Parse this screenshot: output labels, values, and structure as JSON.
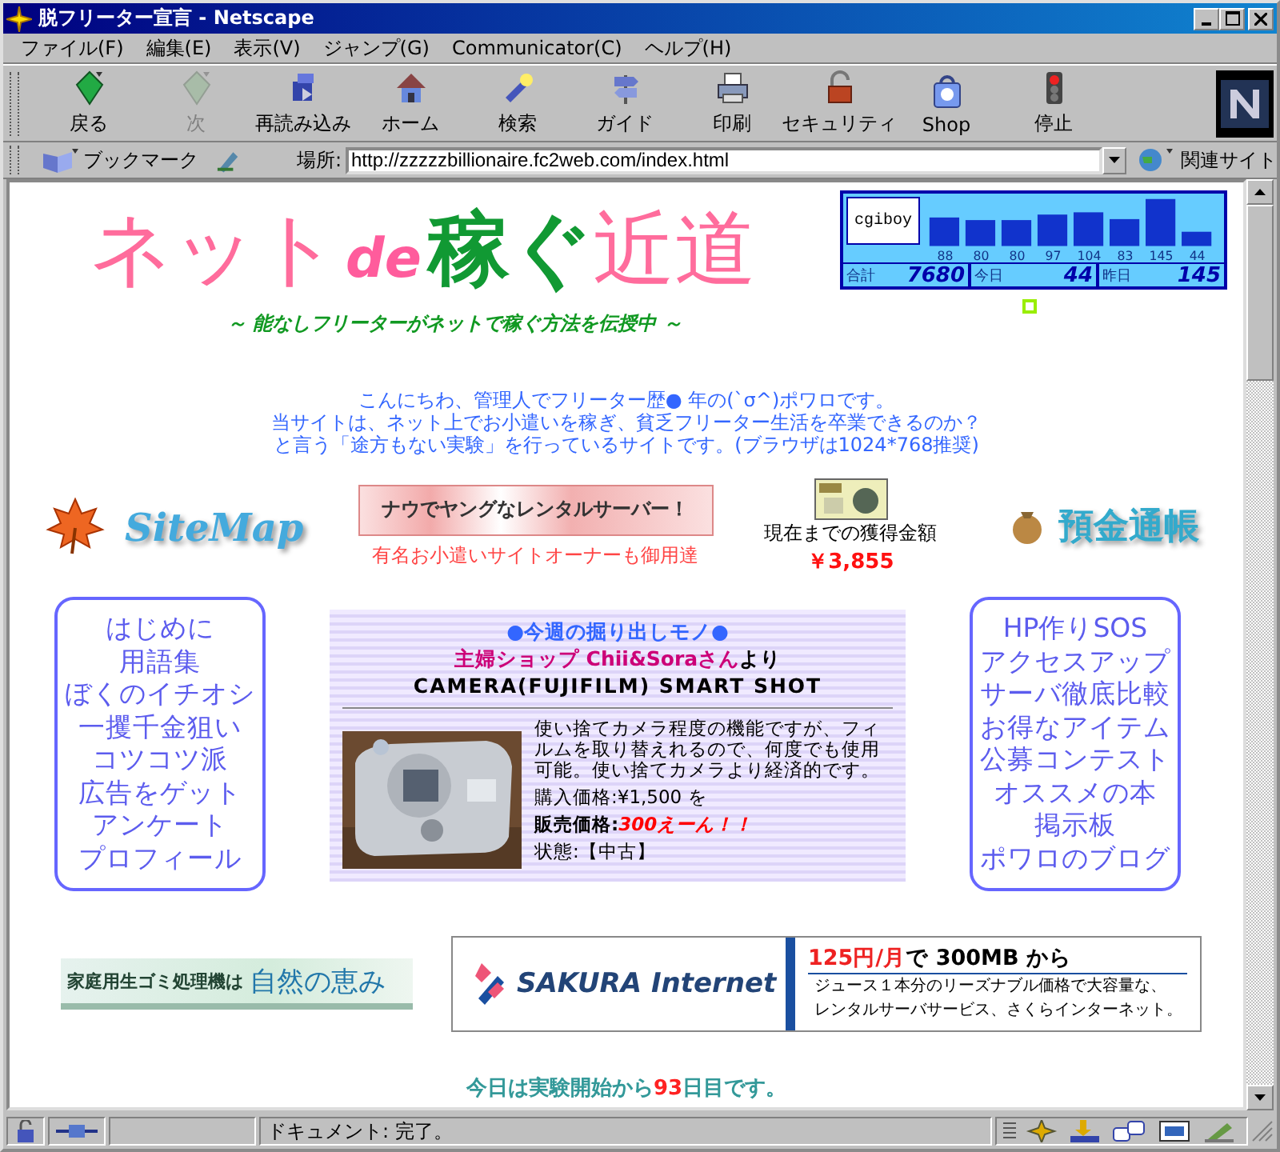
{
  "window": {
    "title": "脱フリーター宣言 - Netscape"
  },
  "menu": [
    "ファイル(F)",
    "編集(E)",
    "表示(V)",
    "ジャンプ(G)",
    "Communicator(C)",
    "ヘルプ(H)"
  ],
  "toolbar": [
    {
      "label": "戻る",
      "disabled": false
    },
    {
      "label": "次",
      "disabled": true
    },
    {
      "label": "再読み込み",
      "disabled": false
    },
    {
      "label": "ホーム",
      "disabled": false
    },
    {
      "label": "検索",
      "disabled": false
    },
    {
      "label": "ガイド",
      "disabled": false
    },
    {
      "label": "印刷",
      "disabled": false
    },
    {
      "label": "セキュリティ",
      "disabled": false
    },
    {
      "label": "Shop",
      "disabled": false
    },
    {
      "label": "停止",
      "disabled": false
    }
  ],
  "location_bar": {
    "bookmarks": "ブックマーク",
    "location_label": "場所:",
    "url": "http://zzzzzbillionaire.fc2web.com/index.html",
    "related": "関連サイト"
  },
  "page": {
    "logo": {
      "part_1": "ネット",
      "part_2": "de",
      "part_3": "稼ぐ",
      "part_4": "近道"
    },
    "tagline": "～ 能なしフリーターがネットで稼ぐ方法を伝授中 ～",
    "counter": {
      "brand": "cgiboy",
      "daily_counts": [
        "88",
        "80",
        "80",
        "97",
        "104",
        "83",
        "145",
        "44"
      ],
      "total_label": "合計",
      "total": "7680",
      "today_label": "今日",
      "today": "44",
      "yesterday_label": "昨日",
      "yesterday": "145"
    },
    "intro": [
      "こんにちわ、管理人でフリーター歴● 年の(`σ^)ポワロです。",
      "当サイトは、ネット上でお小遣いを稼ぎ、貧乏フリーター生活を卒業できるのか？",
      "と言う「途方もない実験」を行っているサイトです。(ブラウザは1024*768推奨)"
    ],
    "sitemap": "SiteMap",
    "rental_banner": "ナウでヤングなレンタルサーバー！",
    "rental_caption": "有名お小遣いサイトオーナーも御用達",
    "earnings_label": "現在までの獲得金額",
    "earnings": "￥3,855",
    "passbook": "預金通帳",
    "left_menu": [
      "はじめに",
      "用語集",
      "ぼくのイチオシ",
      "一攫千金狙い",
      "コツコツ派",
      "広告をゲット",
      "アンケート",
      "プロフィール"
    ],
    "feature": {
      "heading": "●今週の掘り出しモノ●",
      "shop": "主婦ショップ Chii&Soraさん",
      "shop_suffix": "より",
      "product": "CAMERA(FUJIFILM) SMART SHOT",
      "description": "使い捨てカメラ程度の機能ですが、フィルムを取り替えれるので、何度でも使用可能。使い捨てカメラより経済的です。",
      "purchase_price": "購入価格:¥1,500 を",
      "sale_label": "販売価格:",
      "sale_price": "300えーん！！",
      "condition": "状態:【中古】"
    },
    "right_menu": [
      "HP作りSOS",
      "アクセスアップ",
      "サーバ徹底比較",
      "お得なアイテム",
      "公募コンテスト",
      "オススメの本",
      "掲示板",
      "ポワロのブログ"
    ],
    "gomi_ad": {
      "text": "家庭用生ゴミ処理機は",
      "brand": "自然の恵み"
    },
    "sakura_ad": {
      "brand": "SAKURA Internet",
      "price": "125円/月",
      "headline": "で 300MB から",
      "body": [
        "ジュース１本分のリーズナブル価格で大容量な、",
        "レンタルサーバサービス、さくらインターネット。"
      ]
    },
    "footer": {
      "before": "今日は実験開始から",
      "days": "93",
      "after": "日目です。"
    }
  },
  "status_bar": {
    "text": "ドキュメント: 完了。"
  }
}
